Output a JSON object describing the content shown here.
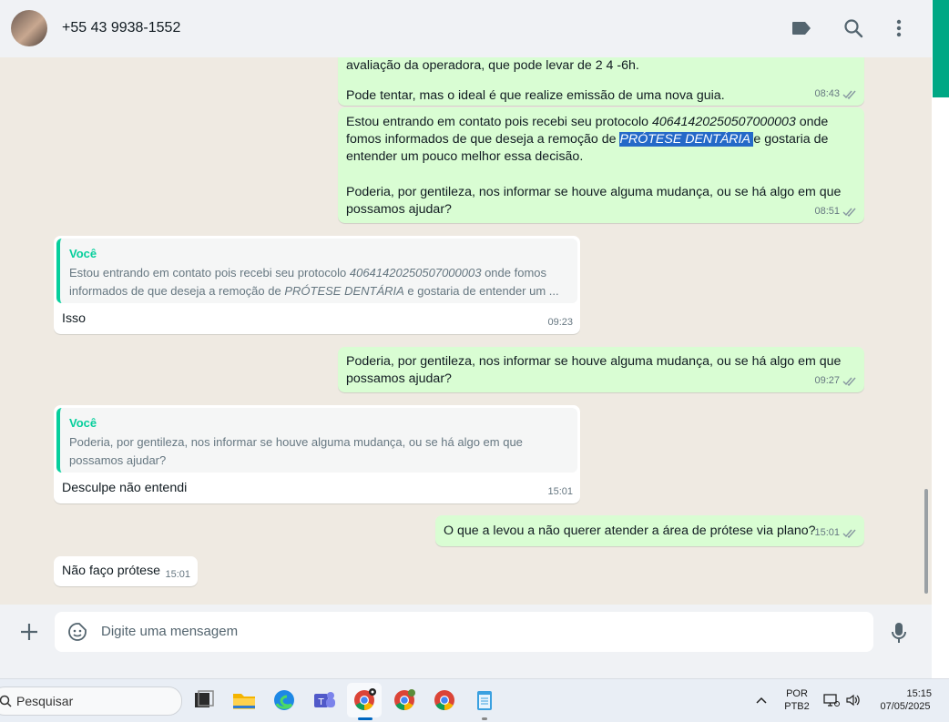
{
  "header": {
    "contact": "+55 43 9938-1552",
    "icons": [
      "label-icon",
      "search-icon",
      "more-vert-icon"
    ]
  },
  "messages": {
    "m0": {
      "partial_top": "avaliação da operadora, que pode levar de 2 4 -6h.",
      "text": "Pode tentar, mas o ideal é que realize emissão de uma nova guia.",
      "time": "08:43"
    },
    "m1": {
      "l1a": "Estou entrando em contato pois recebi seu protocolo ",
      "l1b": "40641420250507000003",
      "l1c": " onde",
      "l2a": "fomos informados de que deseja a remoção de ",
      "l2b": "PRÓTESE DENTÁRIA ",
      "l2c": "e gostaria de",
      "l3": "entender um pouco melhor essa decisão.",
      "l4": "Poderia, por gentileza, nos informar se houve alguma mudança, ou se há algo em que",
      "l5": "possamos ajudar?",
      "time": "08:51"
    },
    "m2": {
      "quote_author": "Você",
      "q1a": "Estou entrando em contato pois recebi seu protocolo ",
      "q1b": "40641420250507000003",
      "q1c": " onde fomos",
      "q2a": "informados de que deseja a remoção de ",
      "q2b": "PRÓTESE DENTÁRIA",
      "q2c": " e gostaria de entender um ...",
      "text": "Isso",
      "time": "09:23"
    },
    "m3": {
      "l1": "Poderia, por gentileza, nos informar se houve alguma mudança, ou se há algo em que",
      "l2": "possamos ajudar?",
      "time": "09:27"
    },
    "m4": {
      "quote_author": "Você",
      "q1": "Poderia, por gentileza, nos informar se houve alguma mudança, ou se há algo em que",
      "q2": "possamos ajudar?",
      "text": "Desculpe não entendi",
      "time": "15:01"
    },
    "m5": {
      "text": "O que a levou a não querer atender a área de prótese via plano?",
      "time": "15:01"
    },
    "m6": {
      "text": "Não faço prótese",
      "time": "15:01"
    }
  },
  "composer": {
    "placeholder": "Digite uma mensagem"
  },
  "taskbar": {
    "search_placeholder": "Pesquisar",
    "lang_top": "POR",
    "lang_bottom": "PTB2",
    "time": "15:15",
    "date": "07/05/2025"
  },
  "colors": {
    "outgoing_bubble": "#d9fdd3",
    "incoming_bubble": "#ffffff",
    "accent": "#00a884",
    "quote_author": "#06cf9c",
    "selection": "#2469c8"
  }
}
